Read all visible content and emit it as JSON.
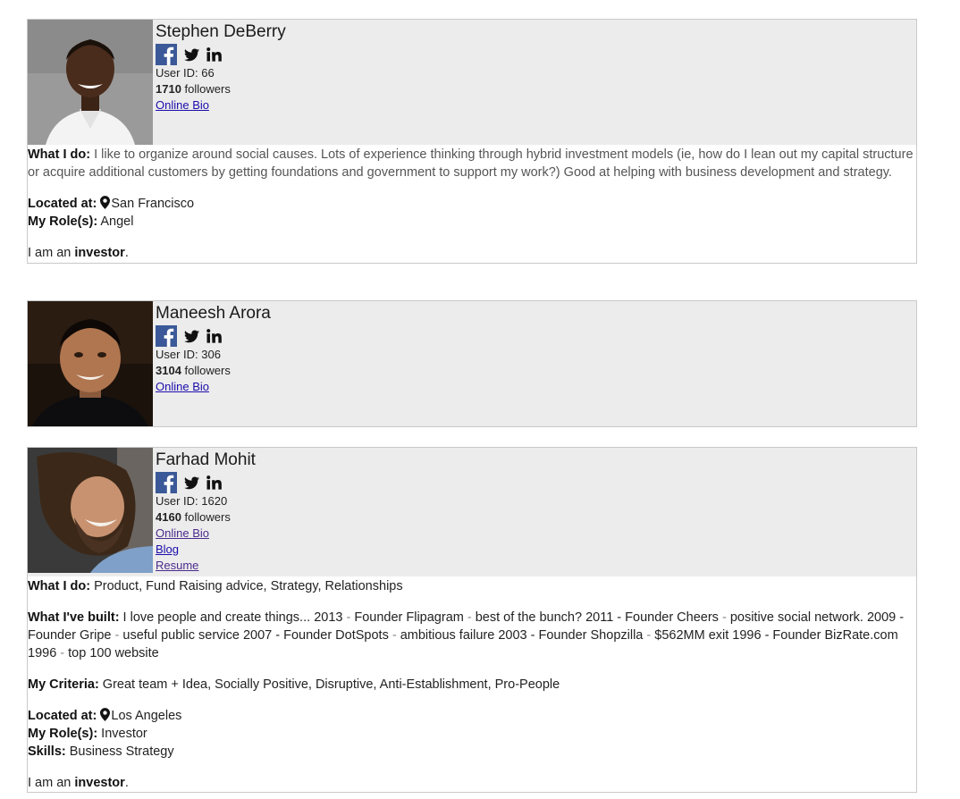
{
  "profiles": [
    {
      "name": "Stephen DeBerry",
      "user_id": "User ID: 66",
      "followers_count": "1710",
      "followers_label": " followers",
      "links": [
        "Online Bio"
      ],
      "what_i_do_label": "What I do:",
      "what_i_do": " I like to organize around social causes. Lots of experience thinking through hybrid investment models (ie, how do I lean out my capital structure or acquire additional customers by getting foundations and government to support my work?) Good at helping with business development and strategy.",
      "located_label": "Located at:",
      "location": "San Francisco",
      "roles_label": "My Role(s):",
      "roles": " Angel",
      "iam_prefix": "I am an ",
      "iam_value": "investor",
      "iam_suffix": "."
    },
    {
      "name": "Maneesh Arora",
      "user_id": "User ID: 306",
      "followers_count": "3104",
      "followers_label": " followers",
      "links": [
        "Online Bio"
      ]
    },
    {
      "name": "Farhad Mohit",
      "user_id": "User ID: 1620",
      "followers_count": "4160",
      "followers_label": " followers",
      "links": [
        "Online Bio",
        "Blog",
        "Resume"
      ],
      "what_i_do_label": "What I do:",
      "what_i_do": " Product, Fund Raising advice, Strategy, Relationships",
      "built_label": "What I've built:",
      "built_intro": " I love people and create things... ",
      "built_items": [
        {
          "year": "2013",
          "sep1": " - ",
          "role": "Founder Flipagram",
          "sep2": " - ",
          "desc": "best of the bunch? 2011"
        },
        {
          "role": " - Founder Cheers",
          "sep2": " - ",
          "desc": "positive social network. 2009"
        },
        {
          "role": " - Founder Gripe",
          "sep2": " - ",
          "desc": "useful public service 2007"
        },
        {
          "role": " - Founder DotSpots",
          "sep2": " - ",
          "desc": "ambitious failure 2003"
        },
        {
          "role": " - Founder Shopzilla",
          "sep2": " - ",
          "desc": "$562MM exit 1996"
        },
        {
          "role": " - Founder BizRate.com 1996",
          "sep2": " - ",
          "desc": "top 100 website"
        }
      ],
      "criteria_label": "My Criteria:",
      "criteria": " Great team + Idea, Socially Positive, Disruptive, Anti-Establishment, Pro-People",
      "located_label": "Located at:",
      "location": "Los Angeles",
      "roles_label": "My Role(s):",
      "roles": " Investor",
      "skills_label": "Skills:",
      "skills": " Business Strategy",
      "iam_prefix": "I am an ",
      "iam_value": "investor",
      "iam_suffix": "."
    }
  ],
  "icons": {
    "facebook": "facebook-icon",
    "twitter": "twitter-icon",
    "linkedin": "linkedin-icon",
    "pin": "location-pin-icon"
  },
  "colors": {
    "facebook": "#3b5998",
    "header_bg": "#ececec",
    "link": "#1a0dab"
  }
}
